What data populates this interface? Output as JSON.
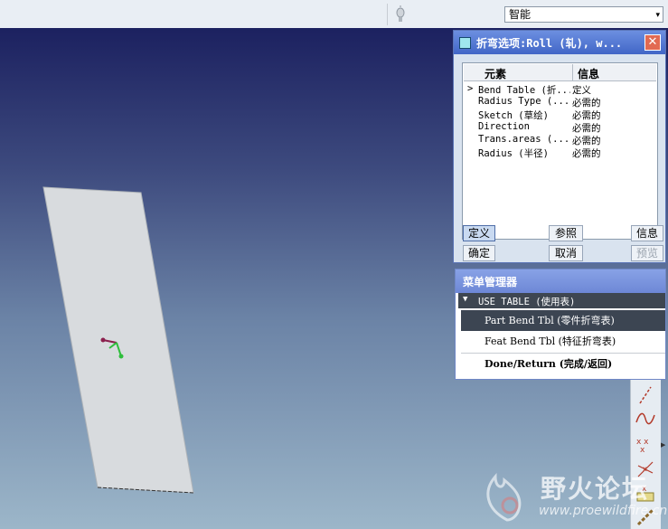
{
  "toolbar": {
    "filter_value": "智能",
    "filter_arrow": "▾"
  },
  "dialog": {
    "title": "折弯选项:Roll (轧), w...",
    "close_glyph": "✕",
    "columns": {
      "element": "元素",
      "info": "信息"
    },
    "rows": [
      {
        "marker": ">",
        "name": "Bend Table (折...",
        "info": "定义"
      },
      {
        "marker": "",
        "name": "Radius Type (...",
        "info": "必需的"
      },
      {
        "marker": "",
        "name": "Sketch (草绘)",
        "info": "必需的"
      },
      {
        "marker": "",
        "name": "Direction",
        "info": "必需的"
      },
      {
        "marker": "",
        "name": "Trans.areas (...",
        "info": "必需的"
      },
      {
        "marker": "",
        "name": "Radius (半径)",
        "info": "必需的"
      }
    ],
    "buttons": {
      "define": "定义",
      "reference": "参照",
      "info": "信息",
      "ok": "确定",
      "cancel": "取消",
      "preview": "预览"
    }
  },
  "menu_manager": {
    "title": "菜单管理器",
    "section": "USE TABLE (使用表)",
    "items": [
      {
        "label": "Part Bend Tbl (零件折弯表)",
        "selected": true
      },
      {
        "label": "Feat Bend Tbl (特征折弯表)",
        "selected": false
      },
      {
        "label": "Done/Return (完成/返回)",
        "selected": false
      }
    ]
  },
  "right_toolbar": {
    "icons": [
      "datum-axis-icon",
      "curve-icon",
      "datum-points-icon",
      "coordinate-system-icon",
      "analysis-icon"
    ]
  },
  "watermark": {
    "title": "野火论坛",
    "url": "www.proewildfire.cn"
  },
  "colors": {
    "accent": "#4166c7",
    "selection": "#3c4552",
    "part_surface": "#d8dbde"
  }
}
